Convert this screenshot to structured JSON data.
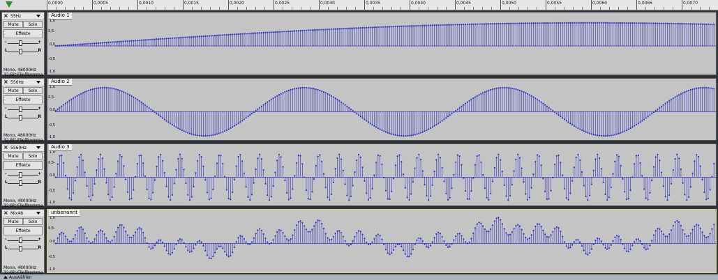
{
  "ruler": {
    "ticks": [
      "0,0000",
      "0,0005",
      "0,0010",
      "0,0015",
      "0,0020",
      "0,0025",
      "0,0030",
      "0,0035",
      "0,0040",
      "0,0045",
      "0,0050",
      "0,0055",
      "0,0060",
      "0,0065",
      "0,0070"
    ]
  },
  "tracks": [
    {
      "header_name": "55Hz",
      "wave_title": "Audio 1",
      "mute": "Mute",
      "solo": "Solo",
      "effects": "Effekte",
      "gain_minus": "-",
      "gain_plus": "+",
      "pan_left": "L",
      "pan_right": "R",
      "info_rate": "Mono, 48000Hz",
      "info_format": "32-Bit-Fließkomma",
      "select": "Auswählen",
      "scale_top": "1,0",
      "scale_mid": "0,0",
      "scale_upper": "0,5-",
      "scale_lower": "-0,5",
      "scale_bottom": "-1,0"
    },
    {
      "header_name": "556Hz",
      "wave_title": "Audio 2",
      "mute": "Mute",
      "solo": "Solo",
      "effects": "Effekte",
      "gain_minus": "-",
      "gain_plus": "+",
      "pan_left": "L",
      "pan_right": "R",
      "info_rate": "Mono, 48000Hz",
      "info_format": "32-Bit-Fließkomma",
      "select": "Auswählen",
      "scale_top": "1,0",
      "scale_mid": "0,0",
      "scale_upper": "0,5-",
      "scale_lower": "-0,5",
      "scale_bottom": "-1,0"
    },
    {
      "header_name": "5569Hz",
      "wave_title": "Audio 3",
      "mute": "Mute",
      "solo": "Solo",
      "effects": "Effekte",
      "gain_minus": "-",
      "gain_plus": "+",
      "pan_left": "L",
      "pan_right": "R",
      "info_rate": "Mono, 48000Hz",
      "info_format": "32-Bit-Fließkomma",
      "select": "Auswählen",
      "scale_top": "1,0",
      "scale_mid": "0,0",
      "scale_upper": "0,5-",
      "scale_lower": "-0,5",
      "scale_bottom": "-1,0"
    },
    {
      "header_name": "Mix48",
      "wave_title": "unbenannt",
      "mute": "Mute",
      "solo": "Solo",
      "effects": "Effekte",
      "gain_minus": "-",
      "gain_plus": "+",
      "pan_left": "L",
      "pan_right": "R",
      "info_rate": "Mono, 48000Hz",
      "info_format": "32-Bit-Fließkomma",
      "select": "Auswählen",
      "scale_top": "1,0",
      "scale_mid": "0,0",
      "scale_upper": "0,5-",
      "scale_lower": "-0,5",
      "scale_bottom": "-1,0"
    }
  ],
  "colors": {
    "waveform": "#3232c8",
    "wave_bg": "#c4c4c4",
    "selected_border": "#d8d86a",
    "playhead": "#2e8b2e"
  }
}
